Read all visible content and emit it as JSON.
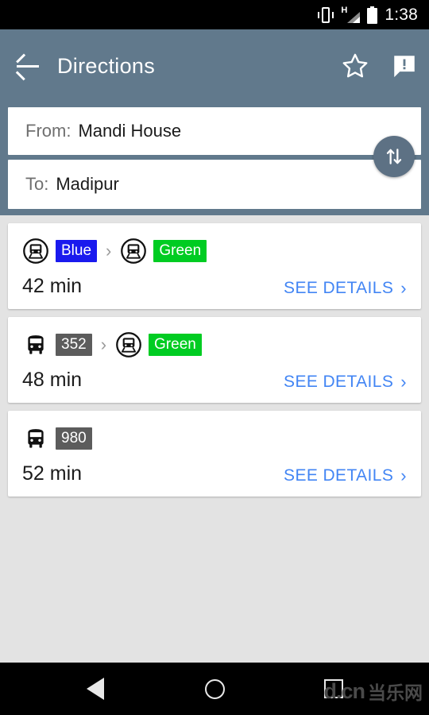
{
  "status_bar": {
    "time": "1:38",
    "icons": [
      "vibrate-icon",
      "signal-h-icon",
      "battery-icon"
    ],
    "network_type": "H"
  },
  "app_bar": {
    "back_label": "back-arrow",
    "title": "Directions",
    "actions": [
      {
        "name": "favorite-star-icon",
        "label": "Favorite"
      },
      {
        "name": "report-issue-icon",
        "label": "Report"
      }
    ]
  },
  "search": {
    "from_label": "From:",
    "from_value": "Mandi House",
    "to_label": "To:",
    "to_value": "Madipur",
    "swap_label": "Swap origin and destination"
  },
  "colors": {
    "app_bar": "#61798c",
    "page_bg": "#e3e3e3",
    "link": "#4285f4",
    "blue_line": "#1a1aee",
    "green_line": "#00cc22",
    "bus_badge": "#5c5c5c"
  },
  "routes": [
    {
      "legs": [
        {
          "mode": "metro",
          "line": "Blue",
          "color": "#1a1aee",
          "text_color": "#ffffff"
        },
        {
          "mode": "metro",
          "line": "Green",
          "color": "#00cc22",
          "text_color": "#ffffff"
        }
      ],
      "duration": "42 min",
      "details_label": "SEE DETAILS"
    },
    {
      "legs": [
        {
          "mode": "bus",
          "line": "352",
          "color": "#5c5c5c",
          "text_color": "#ffffff"
        },
        {
          "mode": "metro",
          "line": "Green",
          "color": "#00cc22",
          "text_color": "#ffffff"
        }
      ],
      "duration": "48 min",
      "details_label": "SEE DETAILS"
    },
    {
      "legs": [
        {
          "mode": "bus",
          "line": "980",
          "color": "#5c5c5c",
          "text_color": "#ffffff"
        }
      ],
      "duration": "52 min",
      "details_label": "SEE DETAILS"
    }
  ],
  "leg_separator": "›",
  "details_chevron": "›",
  "nav_bar": {
    "back": "back-triangle",
    "home": "home-circle",
    "recents": "recents-square"
  },
  "watermark": {
    "latin": "d.cn",
    "chinese": "当乐网"
  }
}
